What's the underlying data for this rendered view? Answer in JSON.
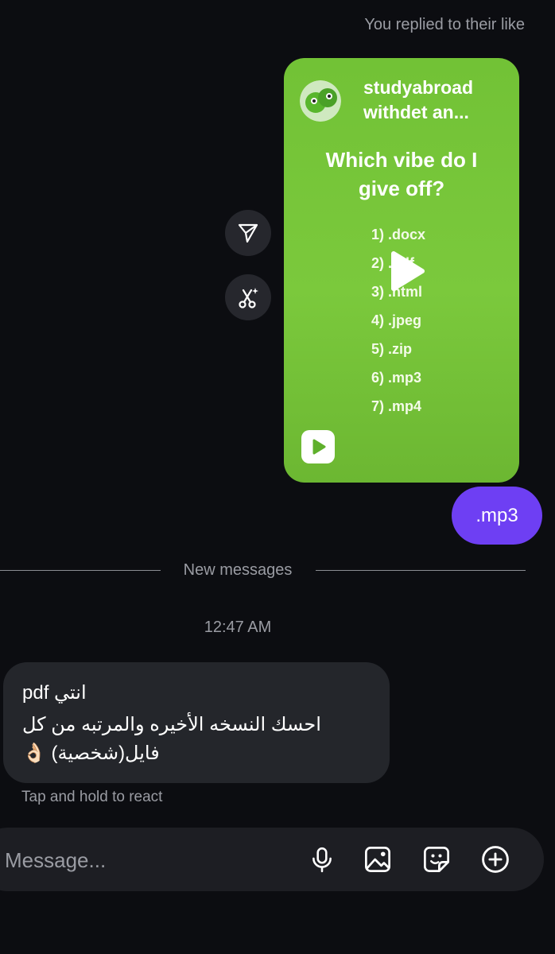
{
  "thread": {
    "reply_note": "You replied to their like",
    "story": {
      "author": "studyabroad withdet an...",
      "question": "Which vibe do I give off?",
      "options": [
        "1) .docx",
        "2) .pdf",
        "3) .html",
        "4) .jpeg",
        "5) .zip",
        "6) .mp3",
        "7) .mp4"
      ]
    },
    "my_message": ".mp3",
    "divider": "New messages",
    "timestamp": "12:47 AM",
    "their_message": {
      "line1": "انتي pdf",
      "line2": "احسك النسخه الأخيره والمرتبه من كل",
      "line3": "فايل(شخصية) 👌🏻"
    },
    "reaction_hint": "Tap and hold to react"
  },
  "composer": {
    "placeholder": "Message...",
    "icons": [
      "microphone-icon",
      "image-icon",
      "sticker-icon",
      "add-icon"
    ]
  },
  "side_actions": [
    "send-icon",
    "ai-remix-icon"
  ],
  "colors": {
    "background": "#0c0d11",
    "accent_bubble": "#6e3ff3",
    "incoming_bubble": "#24262b",
    "story_green": "#77c63a"
  }
}
